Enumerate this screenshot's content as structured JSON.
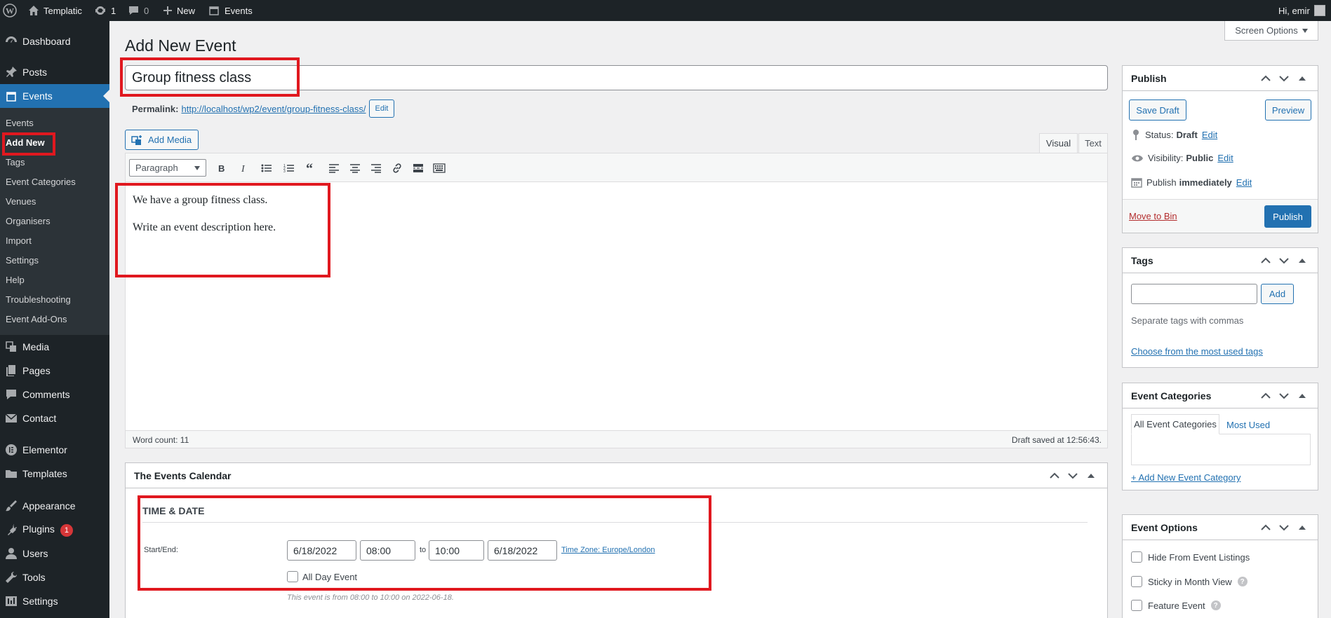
{
  "adminbar": {
    "site_name": "Templatic",
    "updates_count": "1",
    "comments_count": "0",
    "new_label": "New",
    "events_label": "Events",
    "greeting": "Hi, emir"
  },
  "sidebar": {
    "items": [
      {
        "label": "Dashboard",
        "icon": "dashboard-icon"
      },
      {
        "label": "Posts",
        "icon": "pin-icon"
      },
      {
        "label": "Events",
        "icon": "calendar-icon"
      },
      {
        "label": "Media",
        "icon": "media-icon"
      },
      {
        "label": "Pages",
        "icon": "pages-icon"
      },
      {
        "label": "Comments",
        "icon": "comments-icon"
      },
      {
        "label": "Contact",
        "icon": "mail-icon"
      },
      {
        "label": "Elementor",
        "icon": "elementor-icon"
      },
      {
        "label": "Templates",
        "icon": "folder-icon"
      },
      {
        "label": "Appearance",
        "icon": "brush-icon"
      },
      {
        "label": "Plugins",
        "icon": "plug-icon",
        "badge": "1"
      },
      {
        "label": "Users",
        "icon": "user-icon"
      },
      {
        "label": "Tools",
        "icon": "wrench-icon"
      },
      {
        "label": "Settings",
        "icon": "settings-icon"
      }
    ],
    "events_submenu": [
      "Events",
      "Add New",
      "Tags",
      "Event Categories",
      "Venues",
      "Organisers",
      "Import",
      "Settings",
      "Help",
      "Troubleshooting",
      "Event Add-Ons"
    ]
  },
  "screen_options": "Screen Options",
  "page_title": "Add New Event",
  "post_title": "Group fitness class",
  "permalink": {
    "label": "Permalink:",
    "url": "http://localhost/wp2/event/group-fitness-class/",
    "edit_label": "Edit"
  },
  "editor": {
    "add_media": "Add Media",
    "tab_visual": "Visual",
    "tab_text": "Text",
    "format": "Paragraph",
    "paragraphs": [
      "We have a group fitness class.",
      "Write an event description here."
    ],
    "word_count": "Word count: 11",
    "draft_saved": "Draft saved at 12:56:43."
  },
  "events_calendar": {
    "title": "The Events Calendar",
    "section_heading": "TIME & DATE",
    "start_end_label": "Start/End:",
    "start_date": "6/18/2022",
    "start_time": "08:00",
    "to_label": "to",
    "end_time": "10:00",
    "end_date": "6/18/2022",
    "timezone": "Time Zone: Europe/London",
    "all_day": "All Day Event",
    "summary": "This event is from 08:00 to 10:00 on 2022-06-18."
  },
  "publish": {
    "title": "Publish",
    "save_draft": "Save Draft",
    "preview": "Preview",
    "status_label": "Status:",
    "status_value": "Draft",
    "visibility_label": "Visibility:",
    "visibility_value": "Public",
    "publish_label": "Publish",
    "publish_value": "immediately",
    "edit": "Edit",
    "move_to_bin": "Move to Bin",
    "publish_button": "Publish"
  },
  "tags": {
    "title": "Tags",
    "add": "Add",
    "hint": "Separate tags with commas",
    "choose": "Choose from the most used tags"
  },
  "event_categories": {
    "title": "Event Categories",
    "tab_all": "All Event Categories",
    "tab_most": "Most Used",
    "add_new": "+ Add New Event Category"
  },
  "event_options": {
    "title": "Event Options",
    "hide": "Hide From Event Listings",
    "sticky": "Sticky in Month View",
    "feature": "Feature Event"
  },
  "colors": {
    "primary": "#2271b1",
    "admin_dark": "#1d2327",
    "highlight_red": "#e0181f",
    "badge_red": "#d63638"
  }
}
